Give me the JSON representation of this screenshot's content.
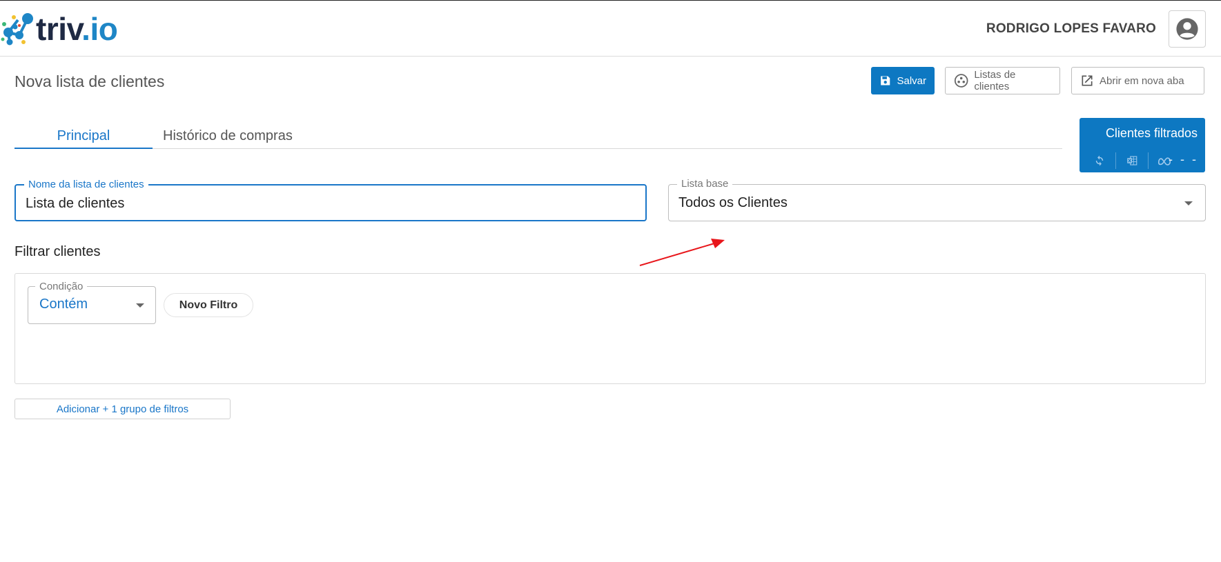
{
  "header": {
    "logo_text_dark": "triv",
    "logo_text_accent": ".io",
    "user_name": "RODRIGO LOPES FAVARO",
    "avatar_icon": "account-circle-icon"
  },
  "page": {
    "title": "Nova lista de clientes",
    "actions": {
      "save_label": "Salvar",
      "lists_label": "Listas de clientes",
      "open_new_tab_label": "Abrir em nova aba"
    }
  },
  "tabs": [
    {
      "label": "Principal",
      "active": true
    },
    {
      "label": "Histórico de compras",
      "active": false
    }
  ],
  "filtered_clients": {
    "title": "Clientes filtrados",
    "count": "- - -",
    "icons": [
      "refresh-icon",
      "excel-icon",
      "meta-icon"
    ]
  },
  "form": {
    "list_name": {
      "label": "Nome da lista de clientes",
      "value": "Lista de clientes"
    },
    "base_list": {
      "label": "Lista base",
      "value": "Todos os Clientes"
    }
  },
  "filters": {
    "section_title": "Filtrar clientes",
    "condition": {
      "label": "Condição",
      "value": "Contém"
    },
    "new_filter_label": "Novo Filtro",
    "add_group_label": "Adicionar + 1 grupo de filtros"
  },
  "colors": {
    "primary": "#0d78c2",
    "accent_text": "#1976c8",
    "annotation_arrow": "#e8161b"
  }
}
